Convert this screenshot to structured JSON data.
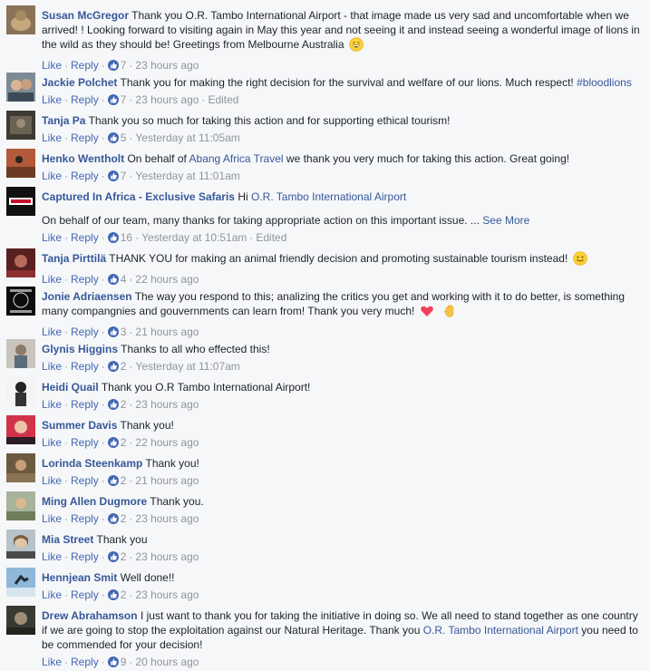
{
  "ui": {
    "like": "Like",
    "reply": "Reply",
    "see_more": "See More",
    "edited": "Edited"
  },
  "comments": [
    {
      "name": "Susan McGregor",
      "text": "Thank you O.R. Tambo International Airport - that image made us very sad and uncomfortable when we arrived! ! Looking forward to visiting again in May this year and not seeing it and instead seeing a wonderful image of lions in the wild as they should be! Greetings from Melbourne Australia",
      "likes": "7",
      "time": "23 hours ago",
      "emoji": "grinning-emoji"
    },
    {
      "name": "Jackie Polchet",
      "text": "Thank you for making the right decision for the survival and welfare of our lions. Much respect!",
      "hashtag": "#bloodlions",
      "likes": "7",
      "time": "23 hours ago",
      "edited": true
    },
    {
      "name": "Tanja Pa",
      "text": "Thank you so much for taking this action and for supporting ethical tourism!",
      "likes": "5",
      "time": "Yesterday at 11:05am"
    },
    {
      "name": "Henko Wentholt",
      "text_before": "On behalf of",
      "mention": "Abang Africa Travel",
      "text_after": "we thank you very much for taking this action. Great going!",
      "likes": "7",
      "time": "Yesterday at 11:01am"
    },
    {
      "name": "Captured In Africa - Exclusive Safaris",
      "text_before": "Hi",
      "mention": "O.R. Tambo International Airport",
      "paragraph": "On behalf of our team, many thanks for taking appropriate action on this important issue. ...",
      "likes": "16",
      "time": "Yesterday at 10:51am",
      "edited": true
    },
    {
      "name": "Tanja Pirttilä",
      "text": "THANK YOU for making an animal friendly decision and promoting sustainable tourism instead!",
      "likes": "4",
      "time": "22 hours ago",
      "emoji": "smiling-emoji"
    },
    {
      "name": "Jonie Adriaensen",
      "text": "The way you respond to this; analizing the critics you get and working with it to do better, is something many compangnies and gouvernments can learn from! Thank you very much!",
      "likes": "3",
      "time": "21 hours ago",
      "emoji": "heart-emoji",
      "emoji2": "raised-hand-emoji"
    },
    {
      "name": "Glynis Higgins",
      "text": "Thanks to all who effected this!",
      "likes": "2",
      "time": "Yesterday at 11:07am"
    },
    {
      "name": "Heidi Quail",
      "text": "Thank you O.R Tambo International Airport!",
      "likes": "2",
      "time": "23 hours ago"
    },
    {
      "name": "Summer Davis",
      "text": "Thank you!",
      "likes": "2",
      "time": "22 hours ago"
    },
    {
      "name": "Lorinda Steenkamp",
      "text": "Thank you!",
      "likes": "2",
      "time": "21 hours ago"
    },
    {
      "name": "Ming Allen Dugmore",
      "text": "Thank you.",
      "likes": "2",
      "time": "23 hours ago"
    },
    {
      "name": "Mia Street",
      "text": "Thank you",
      "likes": "2",
      "time": "23 hours ago"
    },
    {
      "name": "Hennjean Smit",
      "text": "Well done!!",
      "likes": "2",
      "time": "23 hours ago"
    },
    {
      "name": "Drew Abrahamson",
      "text_before": "I just want to thank you for taking the initiative in doing so. We all need to stand together as one country if we are going to stop the exploitation against our Natural Heritage. Thank you",
      "mention": "O.R. Tambo International Airport",
      "text_after": "you need to be commended for your decision!",
      "likes": "9",
      "time": "20 hours ago"
    }
  ],
  "colors": {
    "link": "#365899",
    "action": "#4267b2",
    "meta": "#90949c",
    "background": "#f6f7f9"
  }
}
